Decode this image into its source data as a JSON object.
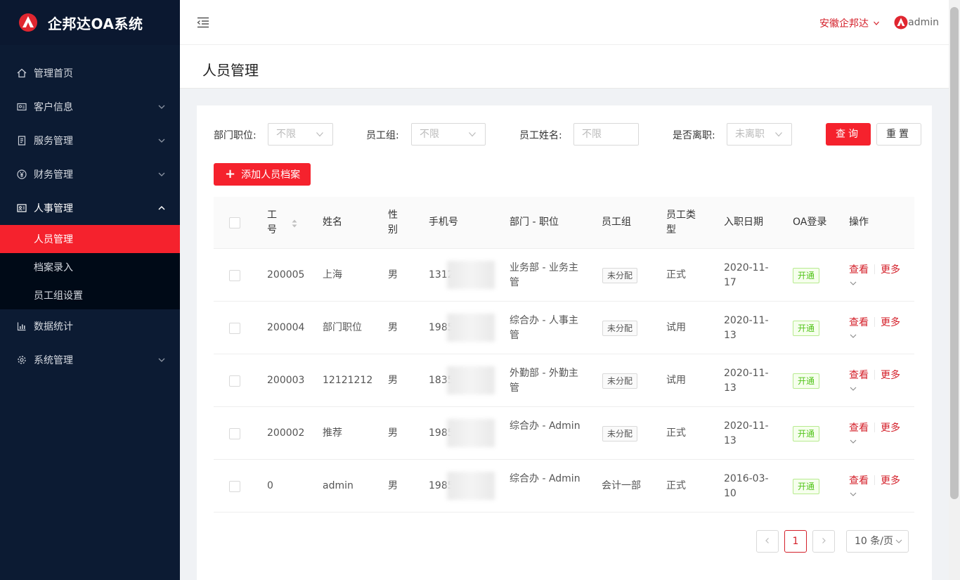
{
  "app": {
    "title": "企邦达OA系统"
  },
  "sidebar": {
    "items": [
      {
        "label": "管理首页",
        "icon": "home-icon",
        "has_children": false
      },
      {
        "label": "客户信息",
        "icon": "id-card-icon",
        "has_children": true
      },
      {
        "label": "服务管理",
        "icon": "document-icon",
        "has_children": true
      },
      {
        "label": "财务管理",
        "icon": "yen-icon",
        "has_children": true
      },
      {
        "label": "人事管理",
        "icon": "profile-icon",
        "has_children": true,
        "open": true
      },
      {
        "label": "数据统计",
        "icon": "bar-chart-icon",
        "has_children": false
      },
      {
        "label": "系统管理",
        "icon": "gear-icon",
        "has_children": true
      }
    ],
    "submenu": [
      {
        "label": "人员管理",
        "active": true
      },
      {
        "label": "档案录入",
        "active": false
      },
      {
        "label": "员工组设置",
        "active": false
      }
    ]
  },
  "header": {
    "company": "安徽企邦达",
    "user": "admin"
  },
  "page": {
    "title": "人员管理"
  },
  "filters": {
    "dept_label": "部门职位:",
    "dept_value": "不限",
    "group_label": "员工组:",
    "group_value": "不限",
    "name_label": "员工姓名:",
    "name_placeholder": "不限",
    "resigned_label": "是否离职:",
    "resigned_value": "未离职",
    "query_label": "查询",
    "reset_label": "重置"
  },
  "add_button": "添加人员档案",
  "table": {
    "headers": {
      "id_1": "工",
      "id_2": "号",
      "name": "姓名",
      "gender_1": "性",
      "gender_2": "别",
      "phone": "手机号",
      "dept": "部门 - 职位",
      "group": "员工组",
      "type_1": "员工类",
      "type_2": "型",
      "date": "入职日期",
      "oa": "OA登录",
      "ops": "操作"
    },
    "rows": [
      {
        "id": "200005",
        "name": "上海",
        "gender": "男",
        "phone": "1312",
        "dept_1": "业务部 - 业务主",
        "dept_2": "管",
        "group": "未分配",
        "type": "正式",
        "date_1": "2020-11-",
        "date_2": "17",
        "oa": "开通",
        "view": "查看",
        "more": "更多"
      },
      {
        "id": "200004",
        "name": "部门职位",
        "gender": "男",
        "phone": "1985",
        "dept_1": "综合办 - 人事主",
        "dept_2": "管",
        "group": "未分配",
        "type": "试用",
        "date_1": "2020-11-",
        "date_2": "13",
        "oa": "开通",
        "view": "查看",
        "more": "更多"
      },
      {
        "id": "200003",
        "name": "12121212",
        "gender": "男",
        "phone": "1835",
        "dept_1": "外勤部 - 外勤主",
        "dept_2": "管",
        "group": "未分配",
        "type": "试用",
        "date_1": "2020-11-",
        "date_2": "13",
        "oa": "开通",
        "view": "查看",
        "more": "更多"
      },
      {
        "id": "200002",
        "name": "推荐",
        "gender": "男",
        "phone": "1985",
        "dept_1": "综合办 - Admin",
        "dept_2": "",
        "group": "未分配",
        "type": "正式",
        "date_1": "2020-11-",
        "date_2": "13",
        "oa": "开通",
        "view": "查看",
        "more": "更多"
      },
      {
        "id": "0",
        "name": "admin",
        "gender": "男",
        "phone": "1985",
        "dept_1": "综合办 - Admin",
        "dept_2": "",
        "group": "会计一部",
        "group_plain": true,
        "type": "正式",
        "date_1": "2016-03-",
        "date_2": "10",
        "oa": "开通",
        "view": "查看",
        "more": "更多"
      }
    ]
  },
  "pagination": {
    "current": "1",
    "page_size": "10 条/页"
  },
  "colors": {
    "accent": "#f5222d",
    "sidebar_bg": "#0c1b33",
    "success": "#52c41a"
  }
}
